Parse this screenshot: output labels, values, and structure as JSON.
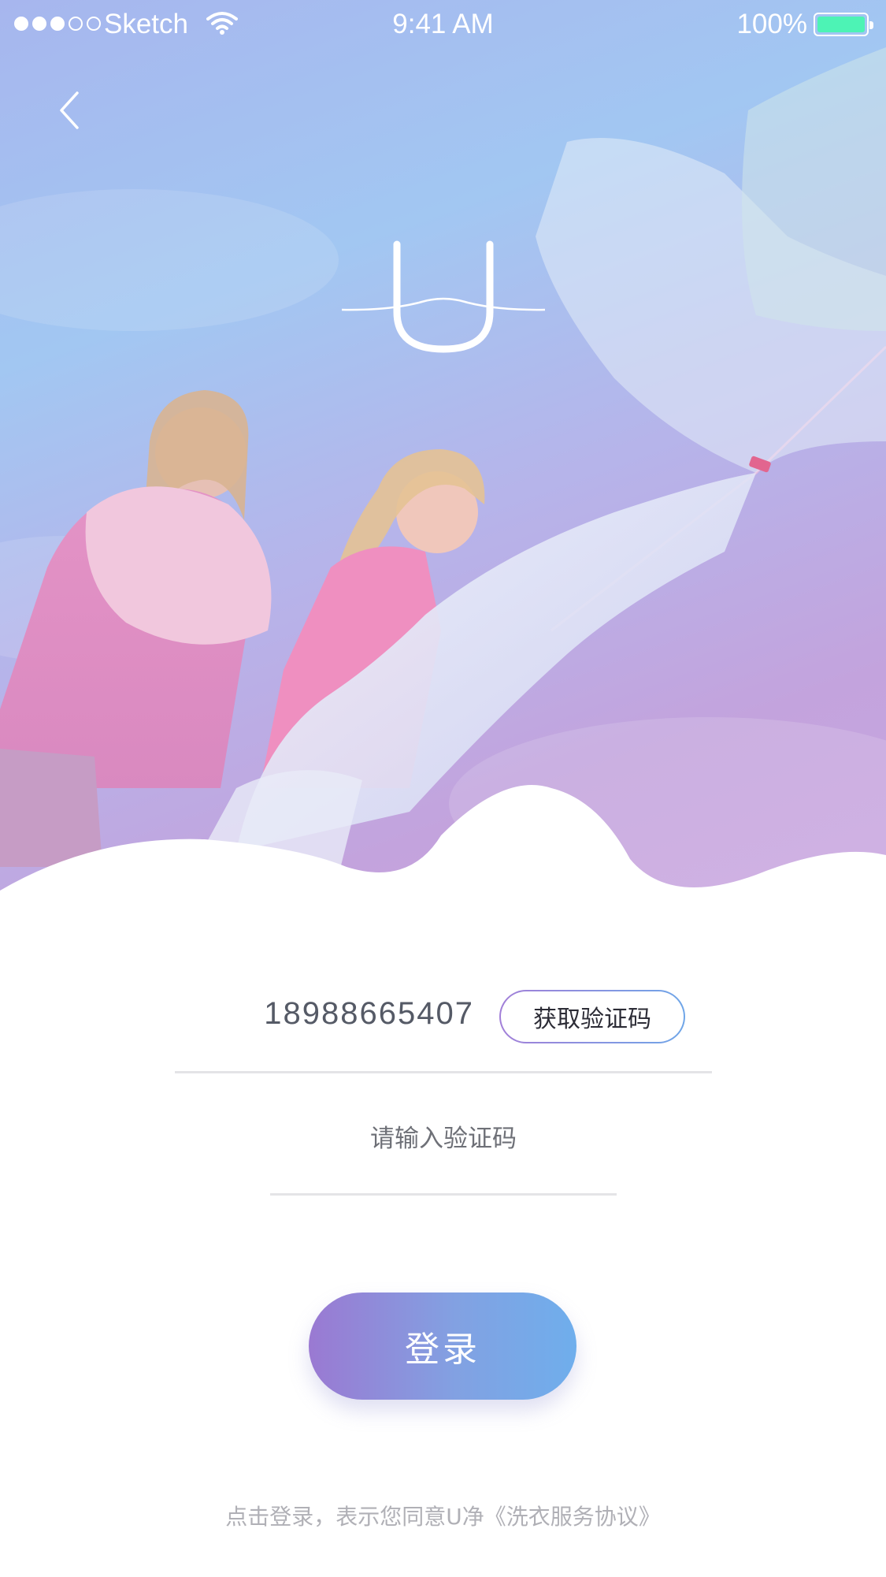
{
  "status_bar": {
    "carrier": "Sketch",
    "time": "9:41 AM",
    "battery": "100%",
    "signal_bars_filled": 3,
    "signal_bars_total": 5,
    "battery_level": 1.0,
    "battery_color": "#4df3b5"
  },
  "header": {
    "back_icon": "chevron-left-icon",
    "logo_letter": "U"
  },
  "form": {
    "phone_number": "18988665407",
    "get_code_label": "获取验证码",
    "code_placeholder": "请输入验证码",
    "code_value": "",
    "login_label": "登录"
  },
  "footer": {
    "agreement_prefix": "点击登录，表示您同意U净",
    "agreement_link": "《洗衣服务协议》"
  },
  "colors": {
    "accent_start": "#9a79d2",
    "accent_end": "#6faeec",
    "divider": "#e4e4e7",
    "muted_text": "#b0b0b6"
  }
}
